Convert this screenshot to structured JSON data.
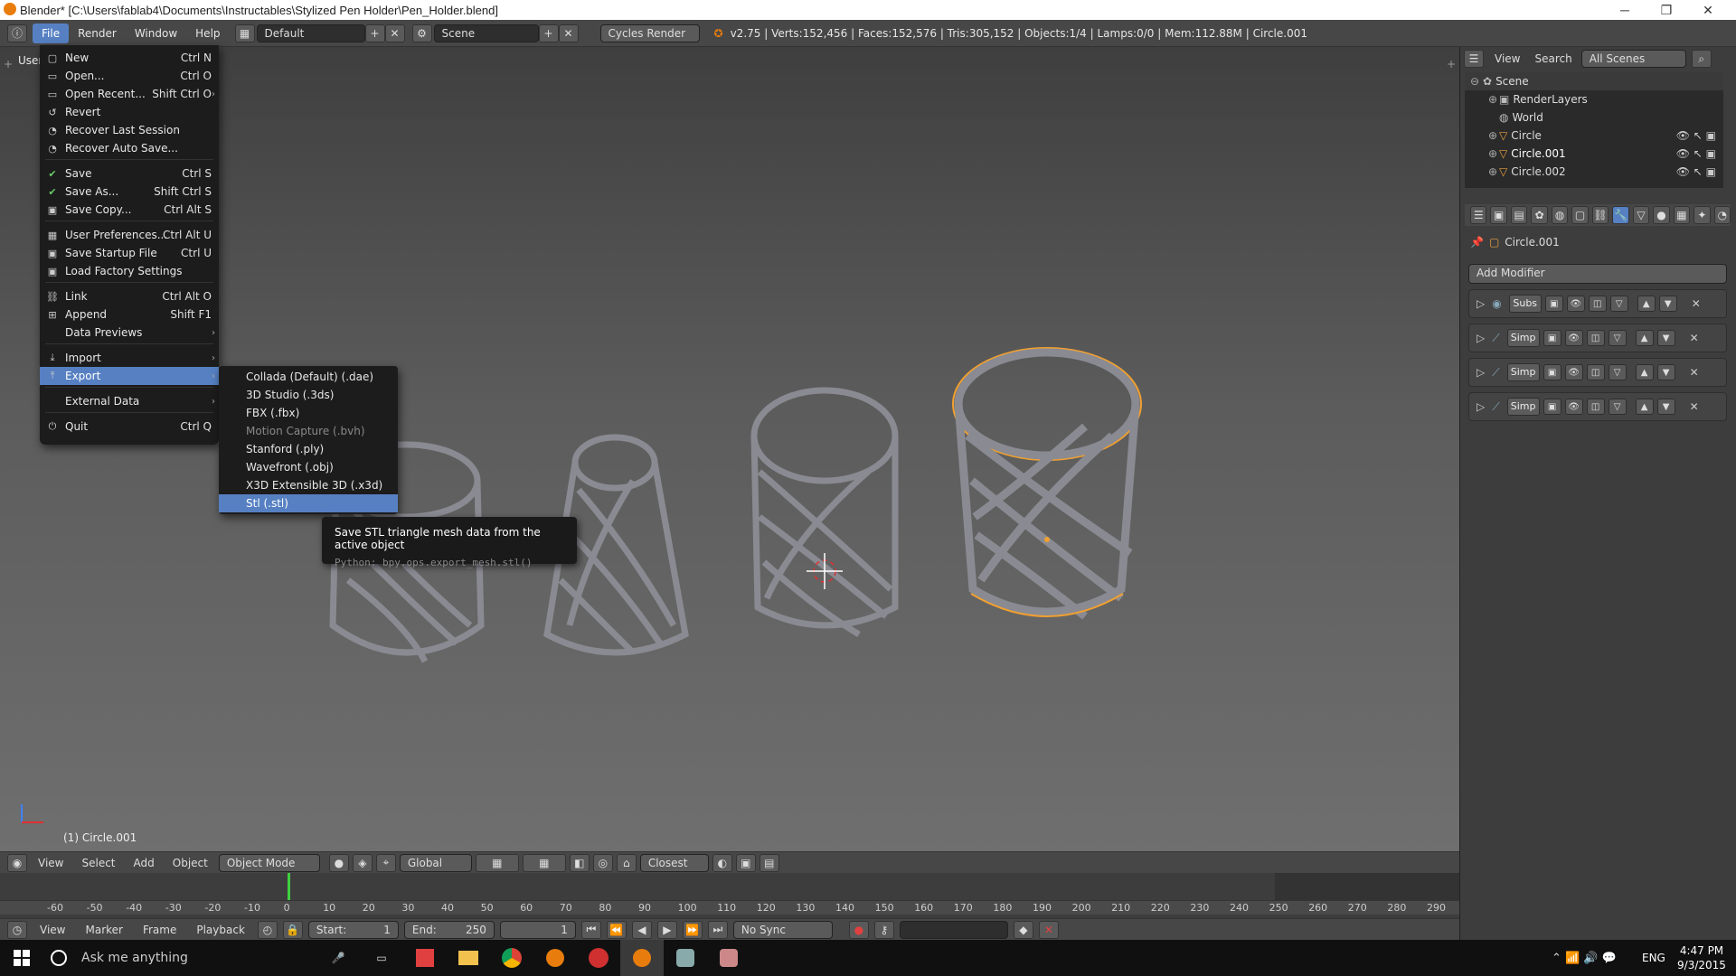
{
  "title_bar": {
    "title": "Blender* [C:\\Users\\fablab4\\Documents\\Instructables\\Stylized Pen Holder\\Pen_Holder.blend]",
    "minimize": "─",
    "maximize": "❐",
    "close": "✕"
  },
  "info_header": {
    "menus": [
      "File",
      "Render",
      "Window",
      "Help"
    ],
    "screen_layout": "Default",
    "scene": "Scene",
    "render_engine": "Cycles Render",
    "stats": "v2.75 | Verts:152,456 | Faces:152,576 | Tris:305,152 | Objects:1/4 | Lamps:0/0 | Mem:112.88M | Circle.001"
  },
  "file_menu": {
    "items": [
      {
        "label": "New",
        "shortcut": "Ctrl N",
        "icon": "new-file-icon"
      },
      {
        "label": "Open...",
        "shortcut": "Ctrl O",
        "icon": "folder-open-icon"
      },
      {
        "label": "Open Recent...",
        "shortcut": "Shift Ctrl O",
        "icon": "recent-icon"
      },
      {
        "label": "Revert",
        "shortcut": "",
        "icon": "revert-icon"
      },
      {
        "label": "Recover Last Session",
        "shortcut": "",
        "icon": "recover-icon"
      },
      {
        "label": "Recover Auto Save...",
        "shortcut": "",
        "icon": "recover-icon"
      },
      {
        "label": "Save",
        "shortcut": "Ctrl S",
        "icon": "check-icon"
      },
      {
        "label": "Save As...",
        "shortcut": "Shift Ctrl S",
        "icon": "check-icon"
      },
      {
        "label": "Save Copy...",
        "shortcut": "Ctrl Alt S",
        "icon": "save-copy-icon"
      },
      {
        "label": "User Preferences...",
        "shortcut": "Ctrl Alt U",
        "icon": "preferences-icon"
      },
      {
        "label": "Save Startup File",
        "shortcut": "Ctrl U",
        "icon": "startup-icon"
      },
      {
        "label": "Load Factory Settings",
        "shortcut": "",
        "icon": "factory-icon"
      },
      {
        "label": "Link",
        "shortcut": "Ctrl Alt O",
        "icon": "link-icon"
      },
      {
        "label": "Append",
        "shortcut": "Shift F1",
        "icon": "append-icon"
      },
      {
        "label": "Data Previews",
        "shortcut": "",
        "icon": ""
      },
      {
        "label": "Import",
        "shortcut": "",
        "icon": "import-icon"
      },
      {
        "label": "Export",
        "shortcut": "",
        "icon": "export-icon"
      },
      {
        "label": "External Data",
        "shortcut": "",
        "icon": ""
      },
      {
        "label": "Quit",
        "shortcut": "Ctrl Q",
        "icon": "power-icon"
      }
    ]
  },
  "export_submenu": {
    "items": [
      {
        "label": "Collada (Default) (.dae)",
        "enabled": true
      },
      {
        "label": "3D Studio (.3ds)",
        "enabled": true
      },
      {
        "label": "FBX (.fbx)",
        "enabled": true
      },
      {
        "label": "Motion Capture (.bvh)",
        "enabled": false
      },
      {
        "label": "Stanford (.ply)",
        "enabled": true
      },
      {
        "label": "Wavefront (.obj)",
        "enabled": true
      },
      {
        "label": "X3D Extensible 3D (.x3d)",
        "enabled": true
      },
      {
        "label": "Stl (.stl)",
        "enabled": true,
        "highlighted": true
      }
    ]
  },
  "tooltip": {
    "description": "Save STL triangle mesh data from the active object",
    "python": "Python: bpy.ops.export_mesh.stl()"
  },
  "viewport": {
    "view_label": "User",
    "object_label": "(1) Circle.001",
    "header": {
      "menus": [
        "View",
        "Select",
        "Add",
        "Object"
      ],
      "mode": "Object Mode",
      "orientation": "Global",
      "snap": "Closest"
    }
  },
  "timeline": {
    "ticks": [
      "-60",
      "-50",
      "-40",
      "-30",
      "-20",
      "-10",
      "0",
      "10",
      "20",
      "30",
      "40",
      "50",
      "60",
      "70",
      "80",
      "90",
      "100",
      "110",
      "120",
      "130",
      "140",
      "150",
      "160",
      "170",
      "180",
      "190",
      "200",
      "210",
      "220",
      "230",
      "240",
      "250",
      "260",
      "270",
      "280",
      "290"
    ],
    "menus": [
      "View",
      "Marker",
      "Frame",
      "Playback"
    ],
    "start_label": "Start:",
    "start": "1",
    "end_label": "End:",
    "end": "250",
    "current": "1",
    "sync": "No Sync"
  },
  "outliner": {
    "header": {
      "view": "View",
      "search": "Search",
      "filter": "All Scenes"
    },
    "rows": [
      {
        "label": "Scene",
        "level": 0
      },
      {
        "label": "RenderLayers",
        "level": 1
      },
      {
        "label": "World",
        "level": 1
      },
      {
        "label": "Circle",
        "level": 1
      },
      {
        "label": "Circle.001",
        "level": 1
      },
      {
        "label": "Circle.002",
        "level": 1
      }
    ]
  },
  "properties": {
    "object_name": "Circle.001",
    "add_modifier": "Add Modifier",
    "modifiers": [
      "Subs",
      "Simp",
      "Simp",
      "Simp"
    ]
  },
  "taskbar": {
    "search_placeholder": "Ask me anything",
    "language": "ENG",
    "time": "4:47 PM",
    "date": "9/3/2015"
  },
  "colors": {
    "highlight": "#5680c2",
    "selection_outline": "#f0a030",
    "menu_bg": "#1c1c1c"
  }
}
